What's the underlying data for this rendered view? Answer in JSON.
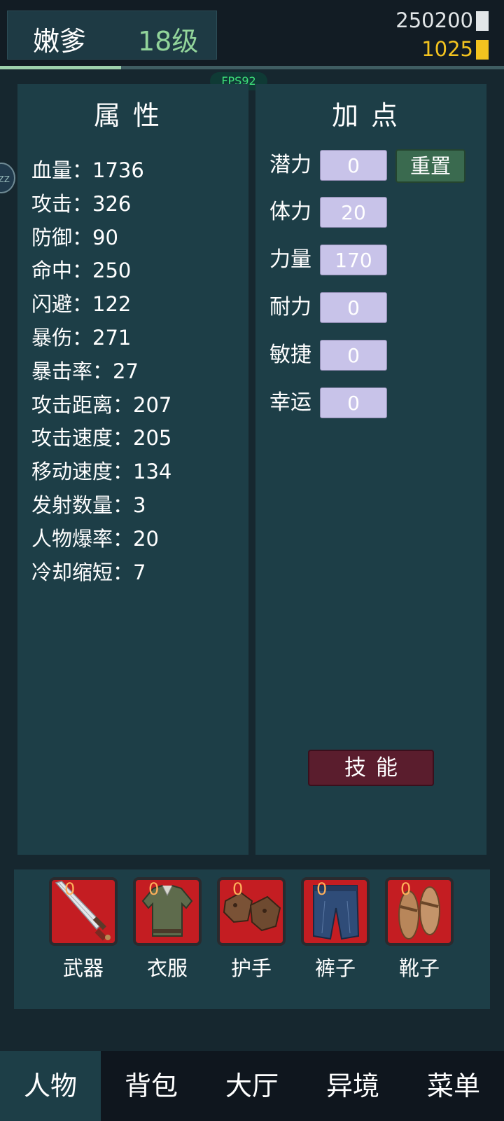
{
  "player": {
    "name": "嫩爹",
    "level": "18级"
  },
  "currency": {
    "silver": "250200",
    "gold": "1025"
  },
  "xp_fraction": 0.24,
  "fps": "FPS92",
  "side_bubble": "ZZ",
  "attributes_panel": {
    "title": "属性",
    "items": [
      "血量：1736",
      "攻击：326",
      "防御：90",
      "命中：250",
      "闪避：122",
      "暴伤：271",
      "暴击率：27",
      "攻击距离：207",
      "攻击速度：205",
      "移动速度：134",
      "发射数量：3",
      "人物爆率：20",
      "冷却缩短：7"
    ]
  },
  "points_panel": {
    "title": "加点",
    "reset_label": "重置",
    "skill_label": "技能",
    "rows": [
      {
        "label": "潜力",
        "value": "0"
      },
      {
        "label": "体力",
        "value": "20"
      },
      {
        "label": "力量",
        "value": "170"
      },
      {
        "label": "耐力",
        "value": "0"
      },
      {
        "label": "敏捷",
        "value": "0"
      },
      {
        "label": "幸运",
        "value": "0"
      }
    ]
  },
  "equipment": [
    {
      "label": "武器",
      "count": "0",
      "icon": "sword-icon"
    },
    {
      "label": "衣服",
      "count": "0",
      "icon": "shirt-icon"
    },
    {
      "label": "护手",
      "count": "0",
      "icon": "gloves-icon"
    },
    {
      "label": "裤子",
      "count": "0",
      "icon": "pants-icon"
    },
    {
      "label": "靴子",
      "count": "0",
      "icon": "sandals-icon"
    }
  ],
  "nav": {
    "active": "人物",
    "tabs": [
      "人物",
      "背包",
      "大厅",
      "异境",
      "菜单"
    ]
  },
  "colors": {
    "background": "#16272f",
    "panel": "#1d3e47",
    "level_text": "#92d49a",
    "gold": "#f3c31f",
    "point_field": "#c8c3e9",
    "reset_button": "#3a6a4f",
    "skill_button": "#5a1d2d",
    "equip_slot": "#c41d22"
  }
}
